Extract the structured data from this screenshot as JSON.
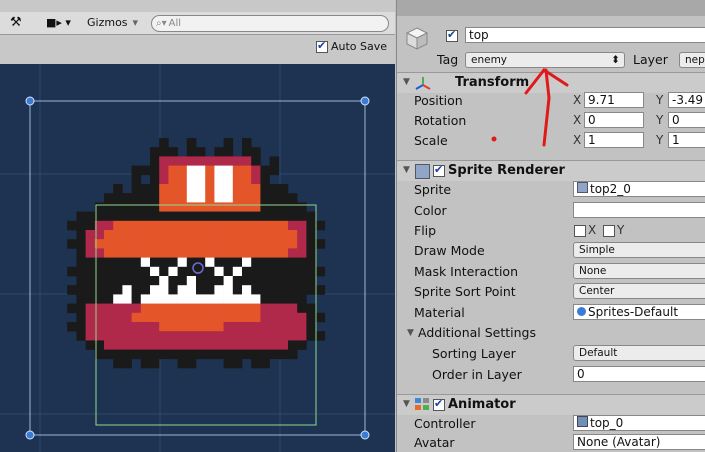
{
  "scene_toolbar": {
    "gizmos_label": "Gizmos",
    "search_placeholder": "All",
    "autosave_label": "Auto Save"
  },
  "inspector": {
    "object_name": "top",
    "tag_label": "Tag",
    "tag_value": "enemy",
    "layer_label": "Layer",
    "layer_value": "nepr",
    "transform": {
      "title": "Transform",
      "position_label": "Position",
      "position_x": "9.71",
      "position_y": "-3.49",
      "rotation_label": "Rotation",
      "rotation_x": "0",
      "rotation_y": "0",
      "scale_label": "Scale",
      "scale_x": "1",
      "scale_y": "1",
      "x_label": "X",
      "y_label": "Y"
    },
    "sprite_renderer": {
      "title": "Sprite Renderer",
      "sprite_label": "Sprite",
      "sprite_value": "top2_0",
      "color_label": "Color",
      "flip_label": "Flip",
      "flip_x": "X",
      "flip_y": "Y",
      "draw_mode_label": "Draw Mode",
      "draw_mode_value": "Simple",
      "mask_label": "Mask Interaction",
      "mask_value": "None",
      "sort_point_label": "Sprite Sort Point",
      "sort_point_value": "Center",
      "material_label": "Material",
      "material_value": "Sprites-Default",
      "additional_label": "Additional Settings",
      "sorting_layer_label": "Sorting Layer",
      "sorting_layer_value": "Default",
      "order_label": "Order in Layer",
      "order_value": "0"
    },
    "animator": {
      "title": "Animator",
      "controller_label": "Controller",
      "controller_value": "top_0",
      "avatar_label": "Avatar",
      "avatar_value": "None (Avatar)"
    }
  },
  "colors": {
    "viewport_bg": "#1d3351",
    "sprite_black": "#1a1a1a",
    "sprite_orange": "#e4562a",
    "sprite_crimson": "#b0284a",
    "sprite_white": "#ffffff",
    "annotation_red": "#e01a1a"
  }
}
